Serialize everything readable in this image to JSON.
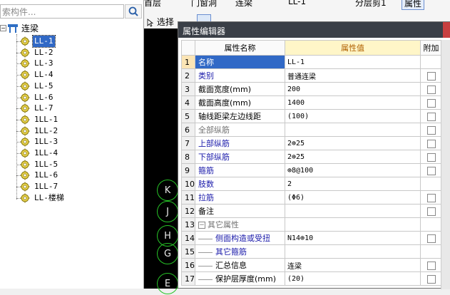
{
  "search": {
    "placeholder": "索构件..."
  },
  "tree": {
    "root_label": "连梁",
    "items": [
      {
        "label": "LL-1",
        "selected": true
      },
      {
        "label": "LL-2"
      },
      {
        "label": "LL-3"
      },
      {
        "label": "LL-4"
      },
      {
        "label": "LL-5"
      },
      {
        "label": "LL-6"
      },
      {
        "label": "LL-7"
      },
      {
        "label": "1LL-1"
      },
      {
        "label": "1LL-2"
      },
      {
        "label": "1LL-3"
      },
      {
        "label": "1LL-4"
      },
      {
        "label": "1LL-5"
      },
      {
        "label": "1LL-6"
      },
      {
        "label": "1LL-7"
      },
      {
        "label": "LL-楼梯"
      }
    ]
  },
  "toolbar": {
    "row1": [
      {
        "label": "首层"
      },
      {
        "label": "门窗洞"
      },
      {
        "label": "连梁"
      },
      {
        "label": "LL-1"
      },
      {
        "label": "分层剪1"
      },
      {
        "label": "属性"
      }
    ],
    "select_label": "选择"
  },
  "canvas": {
    "axes": [
      "K",
      "J",
      "H",
      "G",
      "E"
    ]
  },
  "dialog": {
    "title": "属性编辑器",
    "columns": {
      "name": "属性名称",
      "value": "属性值",
      "extra": "附加"
    },
    "rows": [
      {
        "num": "1",
        "name": "名称",
        "value": "LL-1",
        "style": "blue",
        "checkbox": false,
        "selected": true
      },
      {
        "num": "2",
        "name": "类别",
        "value": "普通连梁",
        "style": "blue",
        "checkbox": true
      },
      {
        "num": "3",
        "name": "截面宽度(mm)",
        "value": "200",
        "style": "",
        "checkbox": true
      },
      {
        "num": "4",
        "name": "截面高度(mm)",
        "value": "1400",
        "style": "",
        "checkbox": true
      },
      {
        "num": "5",
        "name": "轴线距梁左边线距",
        "value": "(100)",
        "style": "",
        "checkbox": true
      },
      {
        "num": "6",
        "name": "全部纵筋",
        "value": "",
        "style": "gray",
        "checkbox": true
      },
      {
        "num": "7",
        "name": "上部纵筋",
        "value": "2⊕25",
        "style": "blue",
        "checkbox": true
      },
      {
        "num": "8",
        "name": "下部纵筋",
        "value": "2⊕25",
        "style": "blue",
        "checkbox": true
      },
      {
        "num": "9",
        "name": "箍筋",
        "value": "⊕8@100",
        "style": "blue",
        "checkbox": true
      },
      {
        "num": "10",
        "name": "肢数",
        "value": "2",
        "style": "blue",
        "checkbox": false
      },
      {
        "num": "11",
        "name": "拉筋",
        "value": "(Φ6)",
        "style": "blue",
        "checkbox": true
      },
      {
        "num": "12",
        "name": "备注",
        "value": "",
        "style": "",
        "checkbox": true
      },
      {
        "num": "13",
        "name": "其它属性",
        "value": "",
        "style": "group",
        "checkbox": false
      },
      {
        "num": "14",
        "name": "侧面构造或受扭",
        "value": "N14⊕10",
        "style": "blue-indent",
        "checkbox": true
      },
      {
        "num": "15",
        "name": "其它箍筋",
        "value": "",
        "style": "blue-indent",
        "checkbox": false
      },
      {
        "num": "16",
        "name": "汇总信息",
        "value": "连梁",
        "style": "indent",
        "checkbox": true
      },
      {
        "num": "17",
        "name": "保护层厚度(mm)",
        "value": "(20)",
        "style": "indent",
        "checkbox": true
      }
    ]
  }
}
